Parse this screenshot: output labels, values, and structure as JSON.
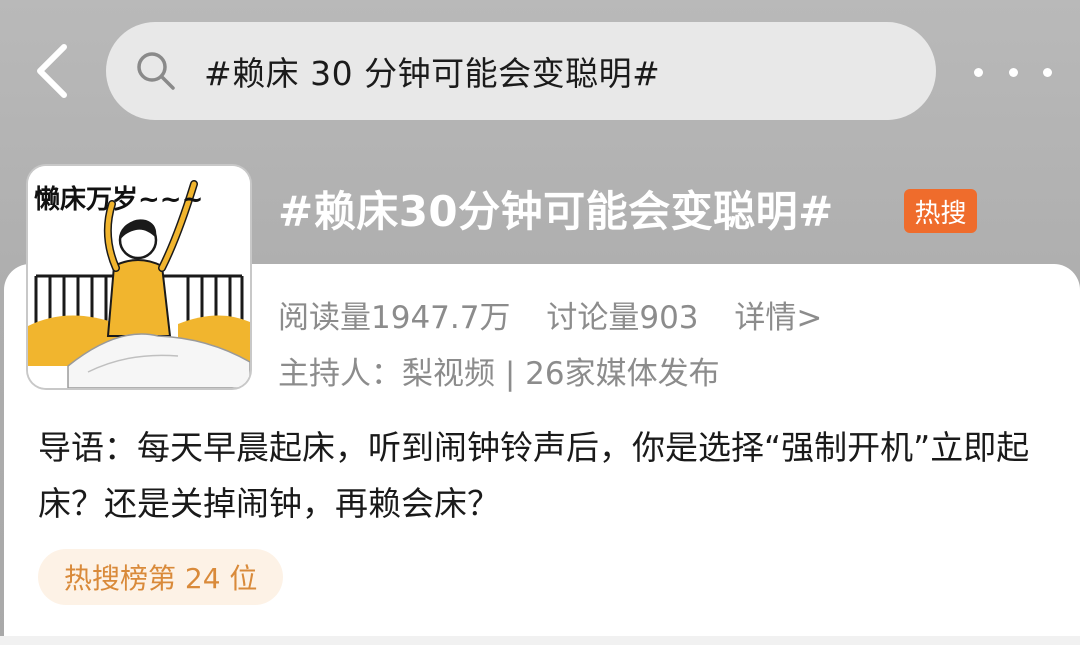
{
  "search": {
    "query": "#赖床 30 分钟可能会变聪明#"
  },
  "topic": {
    "title": "#赖床30分钟可能会变聪明#",
    "badge": "热搜",
    "cover_text": "懒床万岁~~~",
    "stats": {
      "reads": "阅读量1947.7万",
      "discussions": "讨论量903",
      "details_link": "详情>"
    },
    "host": "主持人：梨视频 | 26家媒体发布",
    "lead": "导语：每天早晨起床，听到闹钟铃声后，你是选择“强制开机”立即起床？还是关掉闹钟，再赖会床？",
    "rank": "热搜榜第 24 位"
  },
  "colors": {
    "badge": "#ef6c2c",
    "rank_text": "#d98a3a",
    "rank_bg": "#fdf2e6",
    "meta_text": "#8c8c8c",
    "header_bg": "#aeaeae"
  },
  "icons": {
    "back": "chevron-left-icon",
    "search": "search-icon",
    "more": "more-dots-icon"
  }
}
